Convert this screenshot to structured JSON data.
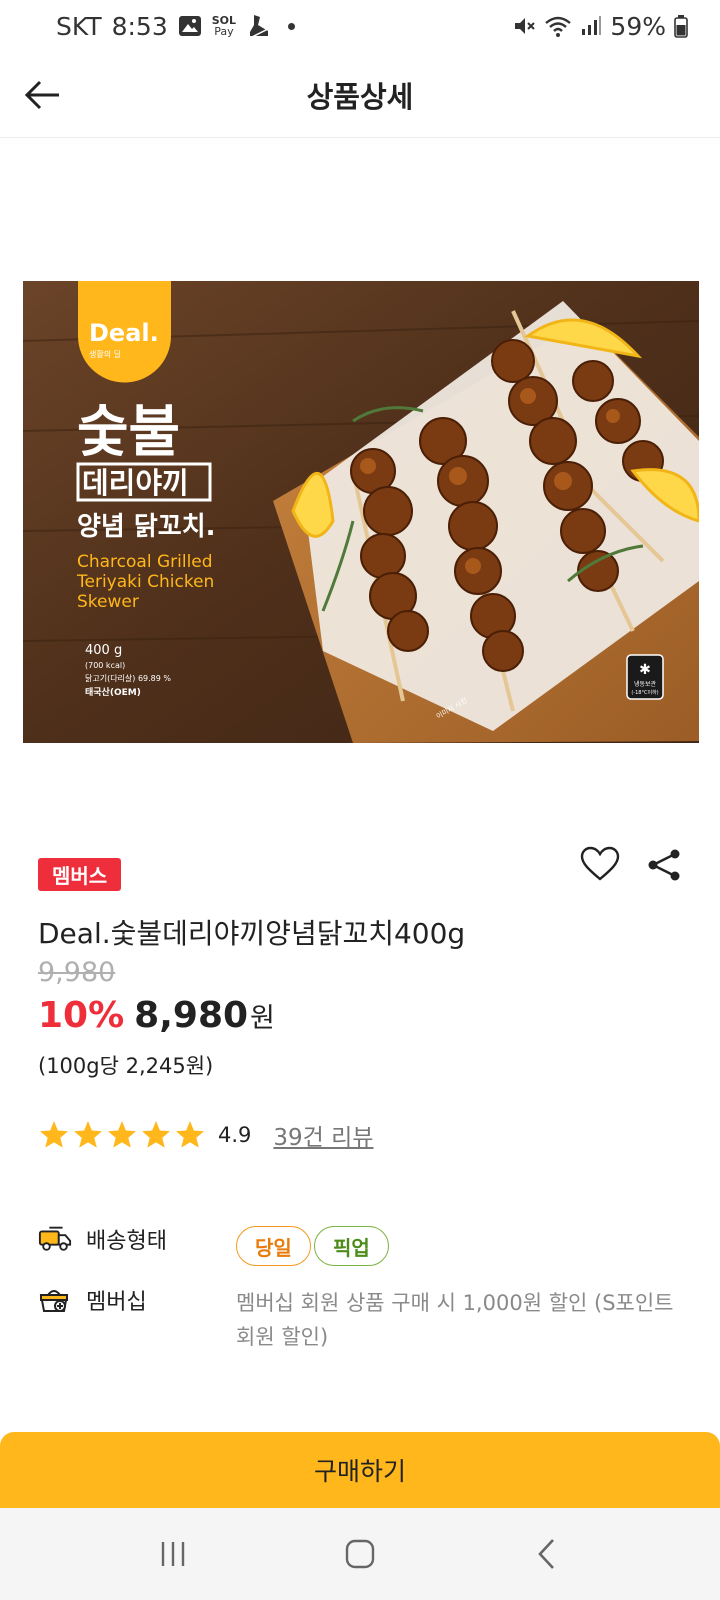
{
  "status_bar": {
    "carrier": "SKT",
    "time": "8:53",
    "pay_label_top": "SOL",
    "pay_label_bottom": "Pay",
    "battery": "59%"
  },
  "header": {
    "title": "상품상세"
  },
  "product_image": {
    "brand": "Deal.",
    "brand_sub": "생활의 딜",
    "title_line1": "숯불",
    "title_line2": "데리야끼",
    "title_line3": "양념 닭꼬치.",
    "eng_line1": "Charcoal Grilled",
    "eng_line2": "Teriyaki Chicken",
    "eng_line3": "Skewer",
    "weight": "400 g",
    "kcal": "(700 kcal)",
    "content": "닭고기(다리살) 69.89 %",
    "origin": "태국산(OEM)",
    "storage_line1": "냉동보관",
    "storage_line2": "(-18°C이하)",
    "image_note": "이미지 사진"
  },
  "product": {
    "badge": "멤버스",
    "name": "Deal.숯불데리야끼양념닭꼬치400g",
    "original_price": "9,980",
    "discount": "10%",
    "sale_price": "8,980",
    "currency": "원",
    "unit_price": "(100g당 2,245원)",
    "rating": 4.9,
    "rating_text": "4.9",
    "review_link": "39건 리뷰"
  },
  "delivery": {
    "label": "배송형태",
    "chips": [
      "당일",
      "픽업"
    ]
  },
  "membership": {
    "label": "멤버십",
    "description": "멤버십 회원 상품 구매 시 1,000원 할인 (S포인트회원 할인)"
  },
  "buy_button": {
    "label": "구매하기"
  },
  "colors": {
    "accent": "#ffb71b",
    "badge_red": "#ee2e3a",
    "star": "#ffb71b"
  }
}
